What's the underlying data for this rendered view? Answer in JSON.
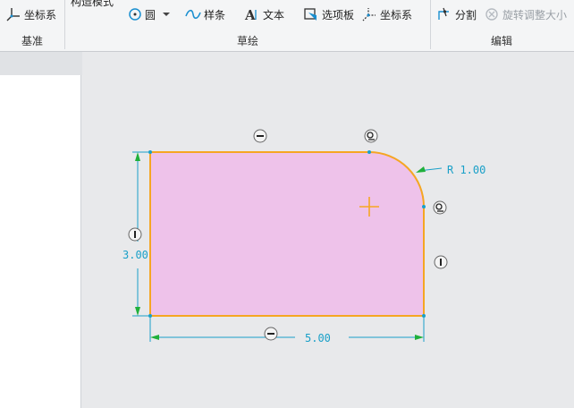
{
  "ribbon": {
    "datum_tools": {
      "csys": "坐标系"
    },
    "construction_mode": "构造模式",
    "sketch_tools": {
      "circle": "圆",
      "spline": "样条",
      "text": "文本",
      "palette": "选项板",
      "csys": "坐标系"
    },
    "edit_tools": {
      "divide": "分割",
      "rotate_resize": "旋转调整大小"
    },
    "groups": {
      "datum": "基准",
      "sketch": "草绘",
      "edit": "编辑"
    }
  },
  "sketch": {
    "radius_dim": "R 1.00",
    "height_dim": "3.00",
    "width_dim": "5.00",
    "colors": {
      "fill": "#eec2ea",
      "outline": "#f5a623",
      "dimension": "#1aa0c8",
      "arrow": "#1fb03a"
    }
  }
}
